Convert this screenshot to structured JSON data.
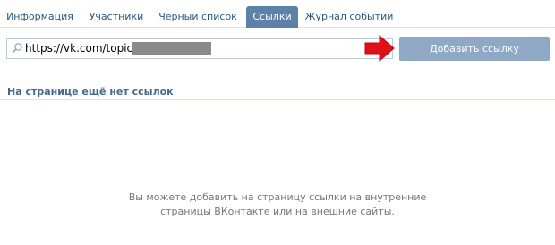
{
  "tabs": [
    {
      "label": "Информация",
      "active": false
    },
    {
      "label": "Участники",
      "active": false
    },
    {
      "label": "Чёрный список",
      "active": false
    },
    {
      "label": "Ссылки",
      "active": true
    },
    {
      "label": "Журнал событий",
      "active": false
    }
  ],
  "link_input": {
    "value": "https://vk.com/topic-3"
  },
  "add_button_label": "Добавить ссылку",
  "section_title": "На странице ещё нет ссылок",
  "empty_message": {
    "line1": "Вы можете добавить на страницу ссылки на внутренние",
    "line2": "страницы ВКонтакте или на внешние сайты."
  },
  "colors": {
    "active_tab_bg": "#5e81a8",
    "button_bg": "#8ea8c5",
    "link_text": "#2b587a",
    "title_text": "#45688e",
    "arrow": "#e0101a"
  },
  "icons": {
    "search": "magnifier",
    "annotation_arrow": "red-arrow-right"
  }
}
